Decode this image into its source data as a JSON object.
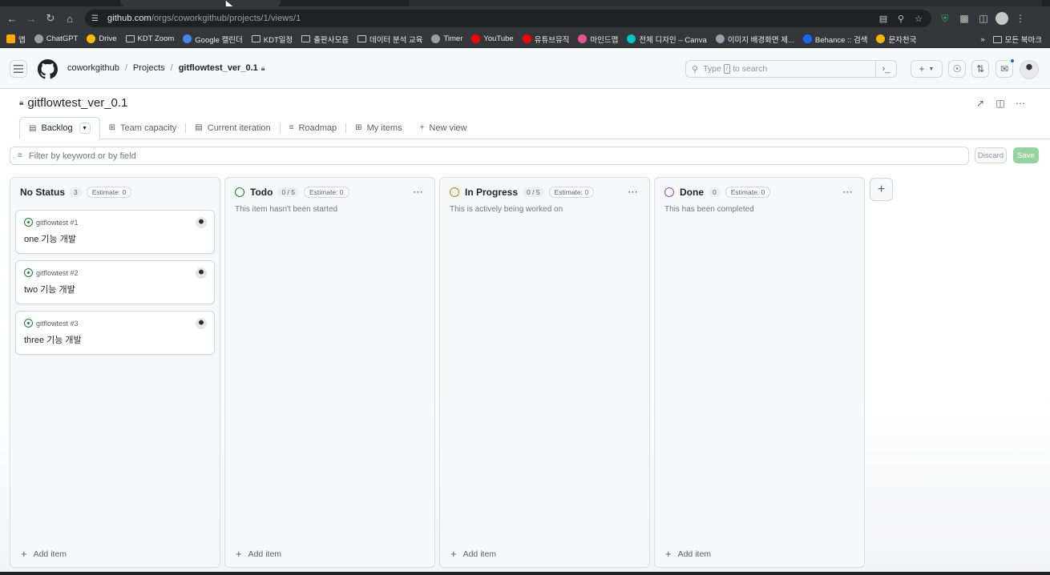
{
  "browser": {
    "url_host": "github.com",
    "url_path": "/orgs/coworkgithub/projects/1/views/1",
    "bookmarks": [
      {
        "label": "앱",
        "icon": "apps-grid-icon",
        "color": "#f9ab00"
      },
      {
        "label": "ChatGPT",
        "icon": "chatgpt-icon",
        "color": "#9aa0a6"
      },
      {
        "label": "Drive",
        "icon": "drive-icon",
        "color": "#fbbc04"
      },
      {
        "label": "KDT Zoom",
        "icon": "folder-icon",
        "color": ""
      },
      {
        "label": "Google 캘린더",
        "icon": "calendar-icon",
        "color": "#4285f4"
      },
      {
        "label": "KDT일정",
        "icon": "folder-icon",
        "color": ""
      },
      {
        "label": "출판사모음",
        "icon": "folder-icon",
        "color": ""
      },
      {
        "label": "데이터 분석 교육",
        "icon": "folder-icon",
        "color": ""
      },
      {
        "label": "Timer",
        "icon": "timer-icon",
        "color": "#9aa0a6"
      },
      {
        "label": "YouTube",
        "icon": "youtube-icon",
        "color": "#ff0000"
      },
      {
        "label": "유튜브뮤직",
        "icon": "youtube-music-icon",
        "color": "#ff0000"
      },
      {
        "label": "마인드맵",
        "icon": "mindmap-icon",
        "color": "#e8538f"
      },
      {
        "label": "전체 디자인 – Canva",
        "icon": "canva-icon",
        "color": "#00c4cc"
      },
      {
        "label": "이미지 배경화면 제...",
        "icon": "image-icon",
        "color": "#9aa0a6"
      },
      {
        "label": "Behance :: 검색",
        "icon": "behance-icon",
        "color": "#1769ff"
      },
      {
        "label": "문자천국",
        "icon": "emoji-icon",
        "color": "#f4b400"
      }
    ],
    "all_bookmarks_label": "모든 북마크"
  },
  "header": {
    "org": "coworkgithub",
    "projects": "Projects",
    "current": "gitflowtest_ver_0.1",
    "search_placeholder_pre": "Type",
    "search_key": "/",
    "search_placeholder_post": "to search"
  },
  "project": {
    "title": "gitflowtest_ver_0.1",
    "views": [
      {
        "label": "Backlog",
        "icon": "board-icon",
        "active": true
      },
      {
        "label": "Team capacity",
        "icon": "table-icon",
        "active": false
      },
      {
        "label": "Current iteration",
        "icon": "board-icon",
        "active": false
      },
      {
        "label": "Roadmap",
        "icon": "roadmap-icon",
        "active": false
      },
      {
        "label": "My items",
        "icon": "table-icon",
        "active": false
      }
    ],
    "new_view": "New view",
    "filter_placeholder": "Filter by keyword or by field",
    "discard": "Discard",
    "save": "Save"
  },
  "columns": [
    {
      "name": "No Status",
      "count": "3",
      "estimate": "Estimate: 0",
      "color": "",
      "description": "",
      "cards": [
        {
          "issue": "gitflowtest #1",
          "title": "one 기능 개발"
        },
        {
          "issue": "gitflowtest #2",
          "title": "two 기능 개발"
        },
        {
          "issue": "gitflowtest #3",
          "title": "three 기능 개발"
        }
      ]
    },
    {
      "name": "Todo",
      "count": "0 / 5",
      "estimate": "Estimate: 0",
      "color": "#1a7f37",
      "description": "This item hasn't been started",
      "cards": []
    },
    {
      "name": "In Progress",
      "count": "0 / 5",
      "estimate": "Estimate: 0",
      "color": "#bf8700",
      "description": "This is actively being worked on",
      "cards": []
    },
    {
      "name": "Done",
      "count": "0",
      "estimate": "Estimate: 0",
      "color": "#8250df",
      "description": "This has been completed",
      "cards": []
    }
  ],
  "add_item": "Add item"
}
